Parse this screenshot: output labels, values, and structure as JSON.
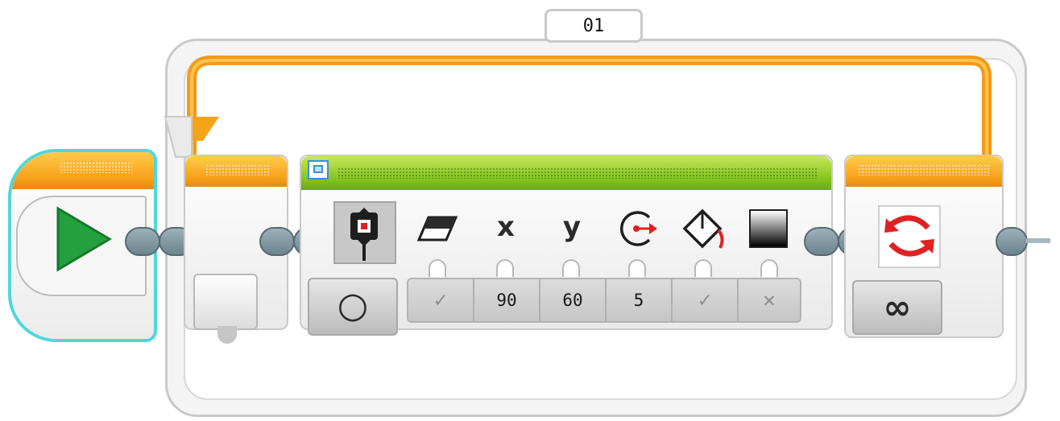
{
  "loop": {
    "name": "01",
    "mode_value": "∞",
    "wire_color": "#f7a21b"
  },
  "start_block": {
    "accent_color": "#4fd7dc",
    "icon": "play-icon"
  },
  "display_block": {
    "header_icon": "display-icon",
    "mode_icon": "shape-mode-icon",
    "mode_selector": "○",
    "params": {
      "clear_screen": {
        "icon": "eraser-icon",
        "value": "✓"
      },
      "x": {
        "label": "x",
        "value": "90"
      },
      "y": {
        "label": "y",
        "value": "60"
      },
      "radius": {
        "icon": "radius-icon",
        "value": "5"
      },
      "fill": {
        "icon": "fill-icon",
        "value": "✓"
      },
      "color": {
        "icon": "color-icon",
        "value": "✕"
      }
    }
  },
  "loop_interrupt": {
    "icon": "loop-interrupt-icon"
  }
}
